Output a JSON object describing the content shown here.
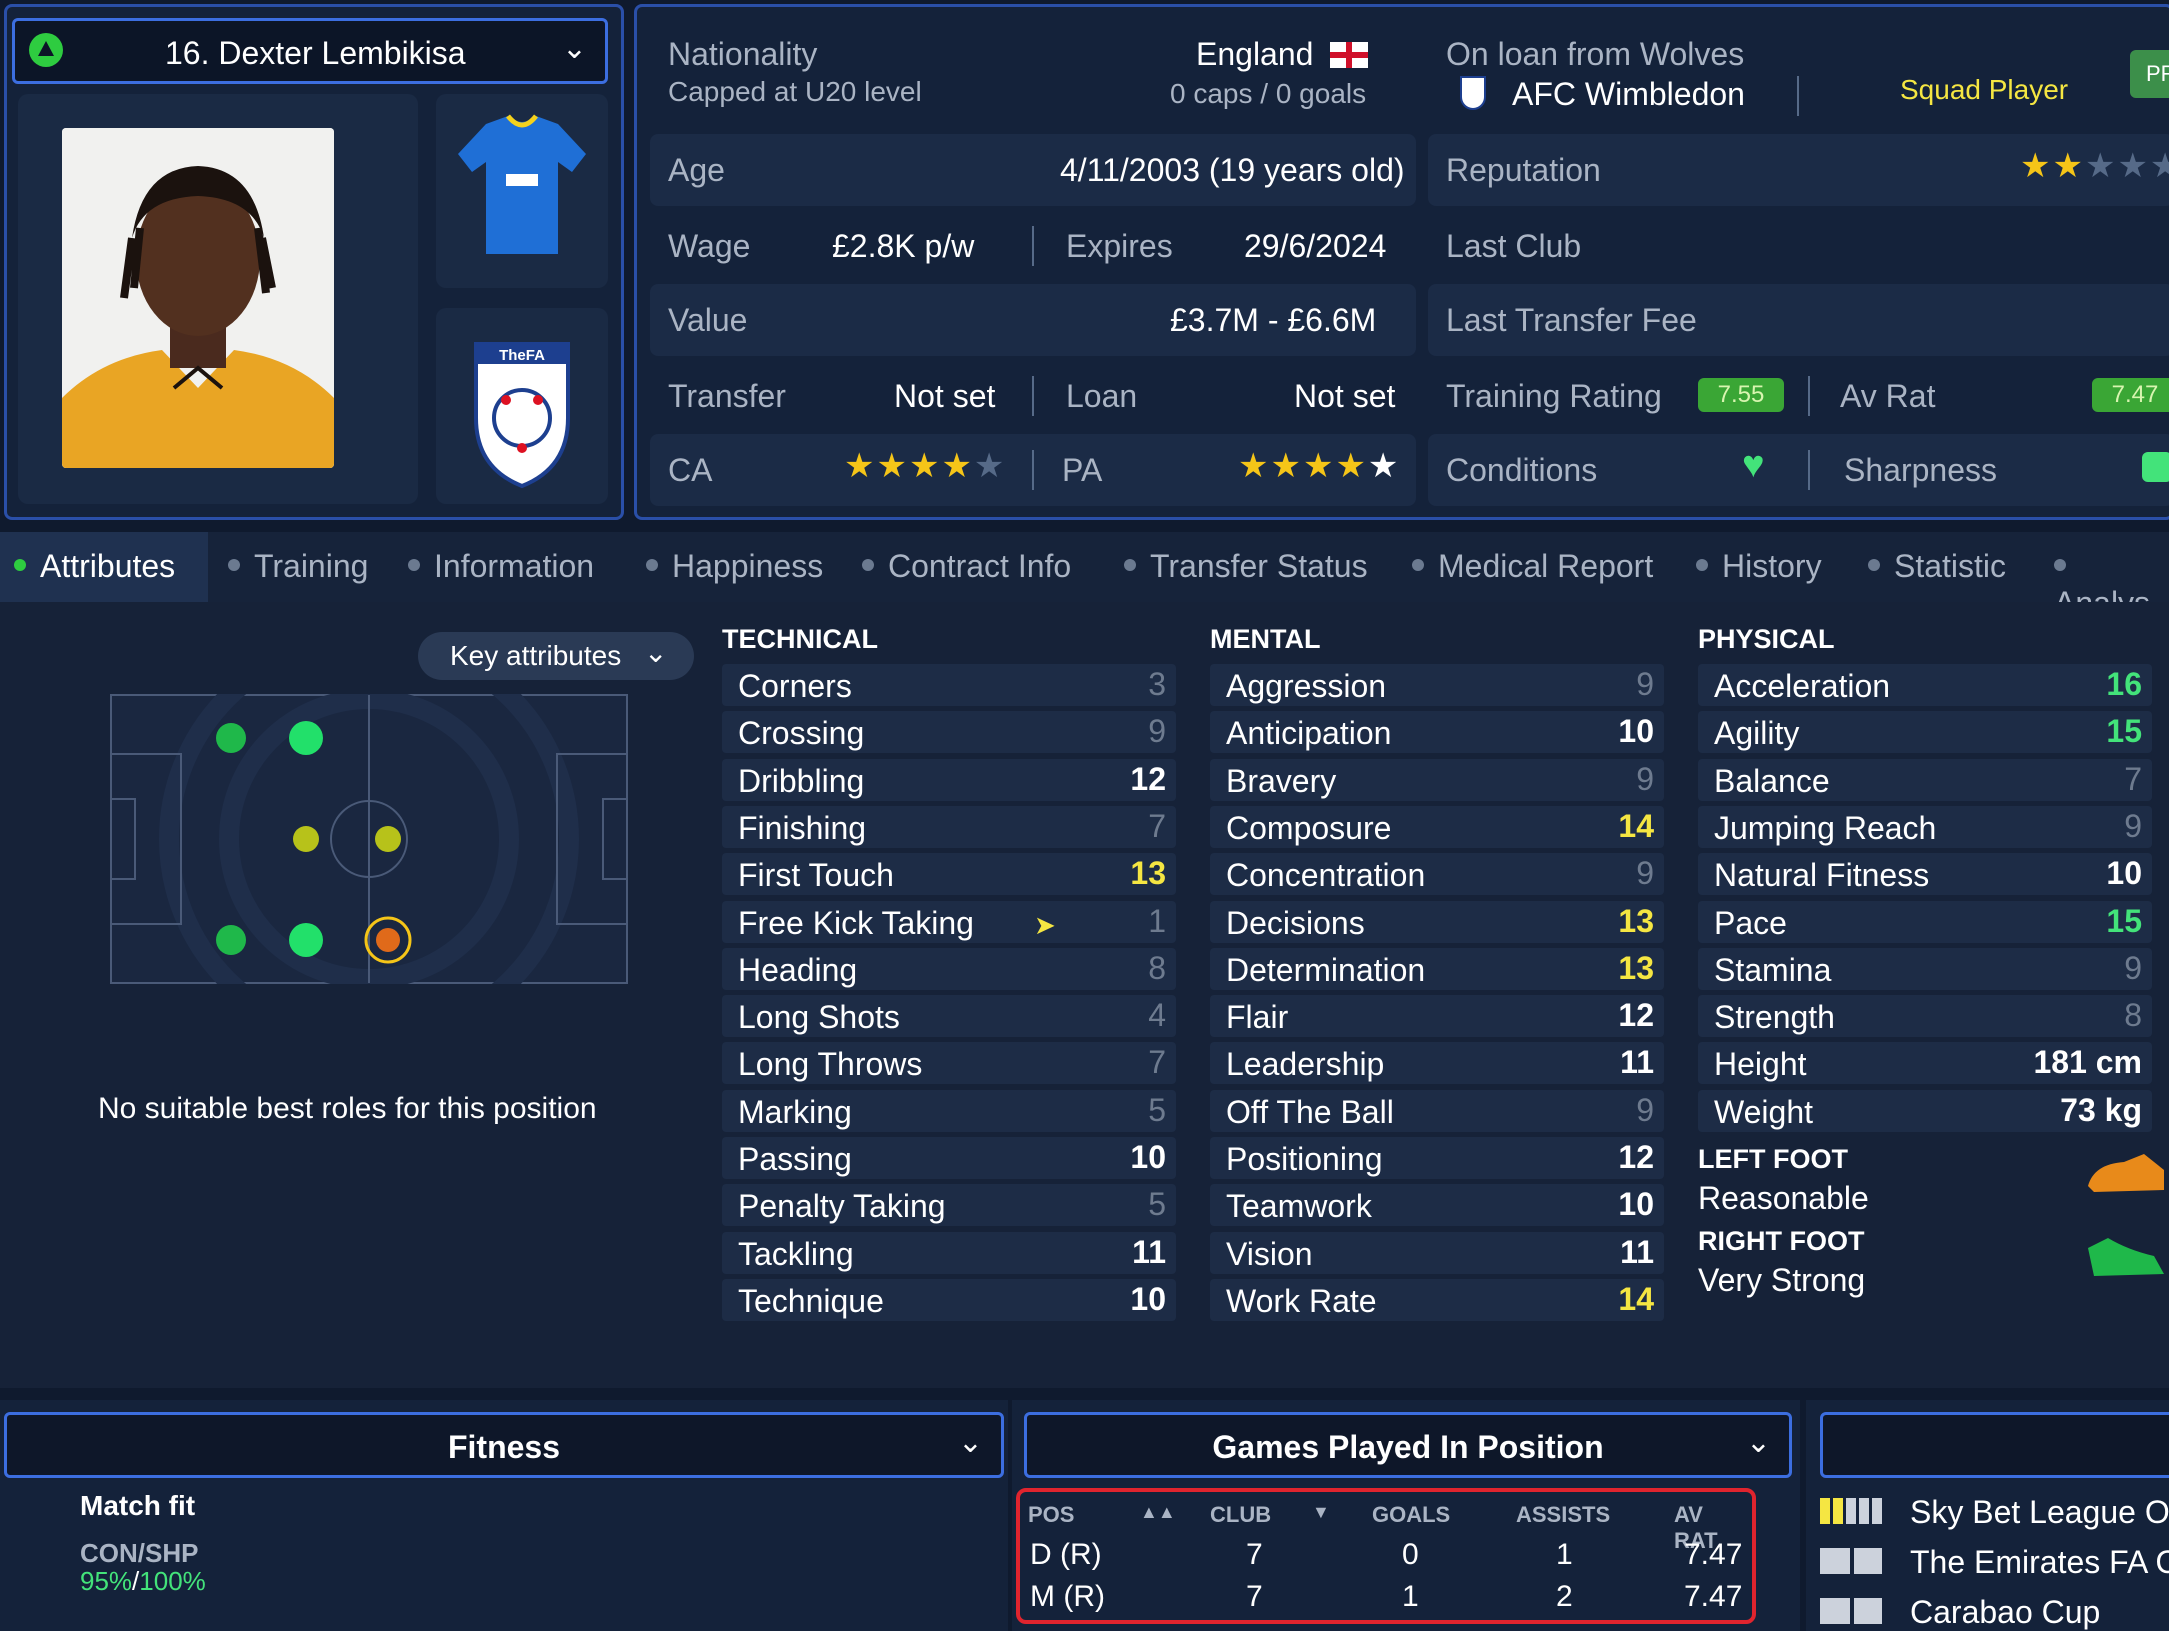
{
  "player": {
    "name": "16. Dexter Lembikisa"
  },
  "info": {
    "nationality_label": "Nationality",
    "nationality": "England",
    "capped_label": "Capped at U20 level",
    "caps": "0 caps / 0 goals",
    "loan_label": "On loan from Wolves",
    "club": "AFC Wimbledon",
    "squad_status": "Squad Player",
    "badge": "PR",
    "age_label": "Age",
    "age": "4/11/2003 (19 years old)",
    "reputation_label": "Reputation",
    "wage_label": "Wage",
    "wage": "£2.8K p/w",
    "expires_label": "Expires",
    "expires": "29/6/2024",
    "last_club_label": "Last Club",
    "value_label": "Value",
    "value": "£3.7M - £6.6M",
    "last_fee_label": "Last Transfer Fee",
    "transfer_label": "Transfer",
    "transfer": "Not set",
    "loan2_label": "Loan",
    "loan": "Not set",
    "training_label": "Training Rating",
    "training": "7.55",
    "avrat_label": "Av Rat",
    "avrat": "7.47",
    "ca_label": "CA",
    "pa_label": "PA",
    "conditions_label": "Conditions",
    "sharpness_label": "Sharpness",
    "ca_stars": 4,
    "pa_stars": 5,
    "reputation_stars": 1.5
  },
  "tabs": [
    "Attributes",
    "Training",
    "Information",
    "Happiness",
    "Contract Info",
    "Transfer Status",
    "Medical Report",
    "History",
    "Statistic",
    "Analys"
  ],
  "key_attributes_label": "Key attributes",
  "no_roles": "No suitable best roles for this position",
  "technical_title": "TECHNICAL",
  "mental_title": "MENTAL",
  "physical_title": "PHYSICAL",
  "technical": [
    {
      "name": "Corners",
      "value": "3"
    },
    {
      "name": "Crossing",
      "value": "9"
    },
    {
      "name": "Dribbling",
      "value": "12"
    },
    {
      "name": "Finishing",
      "value": "7"
    },
    {
      "name": "First Touch",
      "value": "13"
    },
    {
      "name": "Free Kick Taking",
      "value": "1"
    },
    {
      "name": "Heading",
      "value": "8"
    },
    {
      "name": "Long Shots",
      "value": "4"
    },
    {
      "name": "Long Throws",
      "value": "7"
    },
    {
      "name": "Marking",
      "value": "5"
    },
    {
      "name": "Passing",
      "value": "10"
    },
    {
      "name": "Penalty Taking",
      "value": "5"
    },
    {
      "name": "Tackling",
      "value": "11"
    },
    {
      "name": "Technique",
      "value": "10"
    }
  ],
  "mental": [
    {
      "name": "Aggression",
      "value": "9"
    },
    {
      "name": "Anticipation",
      "value": "10"
    },
    {
      "name": "Bravery",
      "value": "9"
    },
    {
      "name": "Composure",
      "value": "14"
    },
    {
      "name": "Concentration",
      "value": "9"
    },
    {
      "name": "Decisions",
      "value": "13"
    },
    {
      "name": "Determination",
      "value": "13"
    },
    {
      "name": "Flair",
      "value": "12"
    },
    {
      "name": "Leadership",
      "value": "11"
    },
    {
      "name": "Off The Ball",
      "value": "9"
    },
    {
      "name": "Positioning",
      "value": "12"
    },
    {
      "name": "Teamwork",
      "value": "10"
    },
    {
      "name": "Vision",
      "value": "11"
    },
    {
      "name": "Work Rate",
      "value": "14"
    }
  ],
  "physical": [
    {
      "name": "Acceleration",
      "value": "16"
    },
    {
      "name": "Agility",
      "value": "15"
    },
    {
      "name": "Balance",
      "value": "7"
    },
    {
      "name": "Jumping Reach",
      "value": "9"
    },
    {
      "name": "Natural Fitness",
      "value": "10"
    },
    {
      "name": "Pace",
      "value": "15"
    },
    {
      "name": "Stamina",
      "value": "9"
    },
    {
      "name": "Strength",
      "value": "8"
    },
    {
      "name": "Height",
      "value": "181 cm"
    },
    {
      "name": "Weight",
      "value": "73 kg"
    }
  ],
  "feet": {
    "left_label": "LEFT FOOT",
    "left": "Reasonable",
    "right_label": "RIGHT FOOT",
    "right": "Very Strong"
  },
  "fitness": {
    "title": "Fitness",
    "match_fit": "Match fit",
    "con_label": "CON/SHP",
    "con": "95%",
    "shp": "100%"
  },
  "games": {
    "title": "Games Played In Position",
    "headers": [
      "POS",
      "CLUB",
      "GOALS",
      "ASSISTS",
      "AV RAT"
    ],
    "rows": [
      [
        "D (R)",
        "7",
        "0",
        "1",
        "7.47"
      ],
      [
        "M (R)",
        "7",
        "1",
        "2",
        "7.47"
      ]
    ]
  },
  "competitions": [
    "Sky Bet League On",
    "The Emirates FA C",
    "Carabao Cup"
  ]
}
